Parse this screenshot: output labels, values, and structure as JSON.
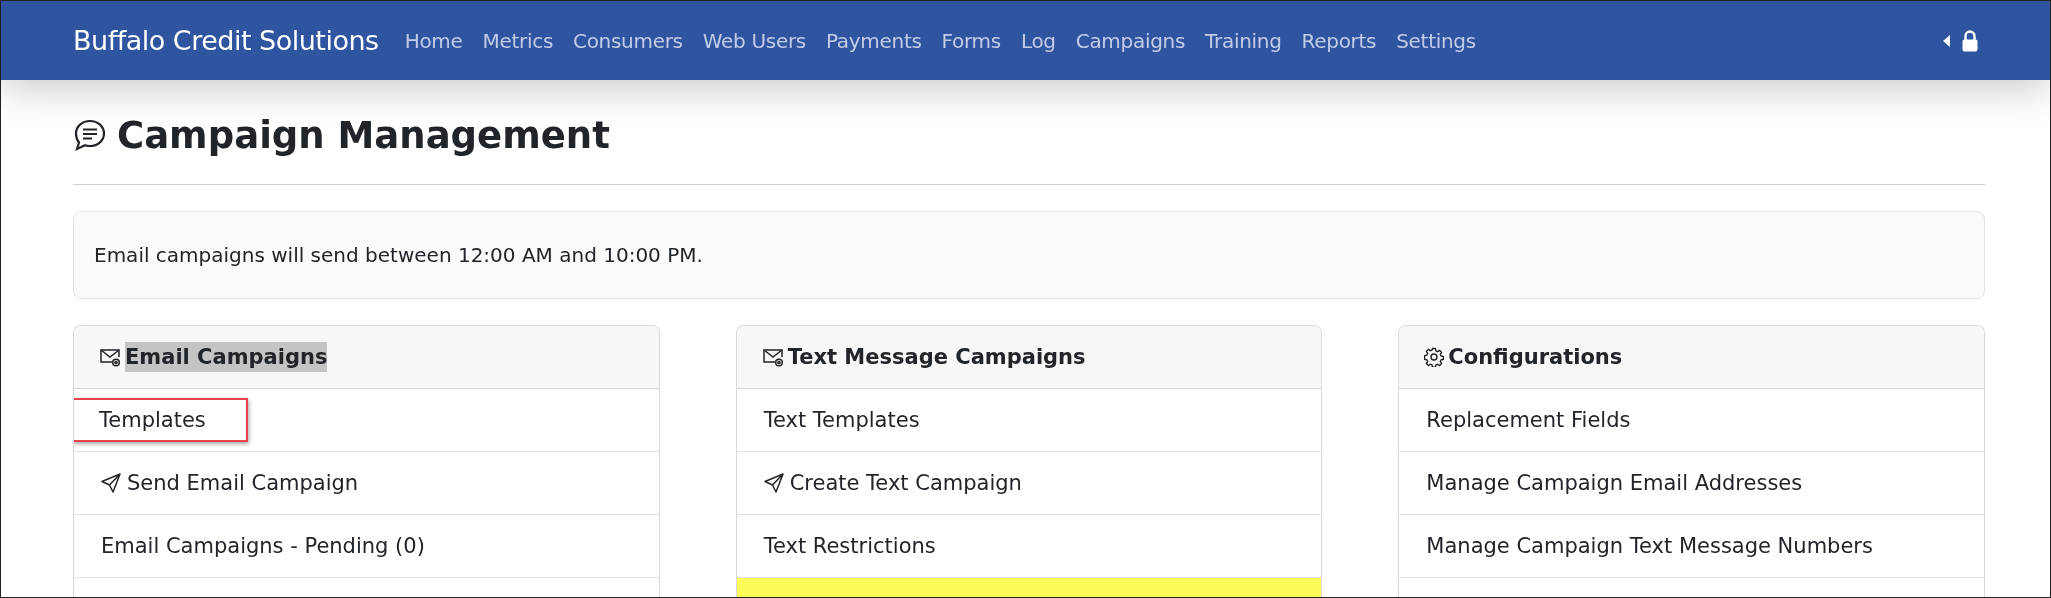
{
  "navbar": {
    "brand": "Buffalo Credit Solutions",
    "links": [
      {
        "label": "Home"
      },
      {
        "label": "Metrics"
      },
      {
        "label": "Consumers"
      },
      {
        "label": "Web Users"
      },
      {
        "label": "Payments"
      },
      {
        "label": "Forms"
      },
      {
        "label": "Log"
      },
      {
        "label": "Campaigns"
      },
      {
        "label": "Training"
      },
      {
        "label": "Reports"
      },
      {
        "label": "Settings"
      }
    ]
  },
  "page_title": "Campaign Management",
  "notice": "Email campaigns will send between 12:00 AM and 10:00 PM.",
  "cards": [
    {
      "title": "Email Campaigns",
      "kind": "mail",
      "highlighted": true,
      "items": [
        {
          "kind": "plain",
          "label": "Templates",
          "annotated": true,
          "highlighted": false
        },
        {
          "kind": "send",
          "label": "Send Email Campaign",
          "annotated": false,
          "highlighted": false
        },
        {
          "kind": "plain",
          "label": "Email Campaigns - Pending (0)",
          "annotated": false,
          "highlighted": false
        },
        {
          "kind": "blank",
          "highlighted": false
        }
      ]
    },
    {
      "title": "Text Message Campaigns",
      "kind": "mail",
      "highlighted": false,
      "items": [
        {
          "kind": "plain",
          "label": "Text Templates",
          "annotated": false,
          "highlighted": false
        },
        {
          "kind": "send",
          "label": "Create Text Campaign",
          "annotated": false,
          "highlighted": false
        },
        {
          "kind": "plain",
          "label": "Text Restrictions",
          "annotated": false,
          "highlighted": false
        },
        {
          "kind": "blank",
          "highlighted": true
        }
      ]
    },
    {
      "title": "Configurations",
      "kind": "settings",
      "highlighted": false,
      "items": [
        {
          "kind": "plain",
          "label": "Replacement Fields",
          "annotated": false,
          "highlighted": false
        },
        {
          "kind": "plain",
          "label": "Manage Campaign Email Addresses",
          "annotated": false,
          "highlighted": false
        },
        {
          "kind": "plain",
          "label": "Manage Campaign Text Message Numbers",
          "annotated": false,
          "highlighted": false
        },
        {
          "kind": "blank",
          "highlighted": false
        }
      ]
    }
  ]
}
